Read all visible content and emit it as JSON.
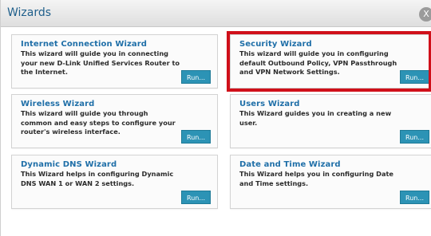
{
  "window": {
    "title": "Wizards",
    "close_label": "X"
  },
  "wizards": [
    {
      "title": "Internet Connection Wizard",
      "description": "This wizard will guide you in connecting your new D-Link Unified Services Router to the Internet.",
      "run_label": "Run..."
    },
    {
      "title": "Security Wizard",
      "description": "This wizard will guide you in configuring default Outbound Policy, VPN Passthrough and VPN Network Settings.",
      "run_label": "Run..."
    },
    {
      "title": "Wireless Wizard",
      "description": "This wizard will guide you through common and easy steps to configure your router's wireless interface.",
      "run_label": "Run..."
    },
    {
      "title": "Users Wizard",
      "description": "This Wizard guides you in creating a new user.",
      "run_label": "Run..."
    },
    {
      "title": "Dynamic DNS Wizard",
      "description": "This Wizard helps in configuring Dynamic DNS WAN 1 or WAN 2 settings.",
      "run_label": "Run..."
    },
    {
      "title": "Date and Time Wizard",
      "description": "This Wizard helps you in configuring Date and Time settings.",
      "run_label": "Run..."
    }
  ],
  "colors": {
    "title": "#1f5f8b",
    "panel_title": "#1f6fa8",
    "run_button": "#2c93b5",
    "highlight": "#d0101a"
  }
}
